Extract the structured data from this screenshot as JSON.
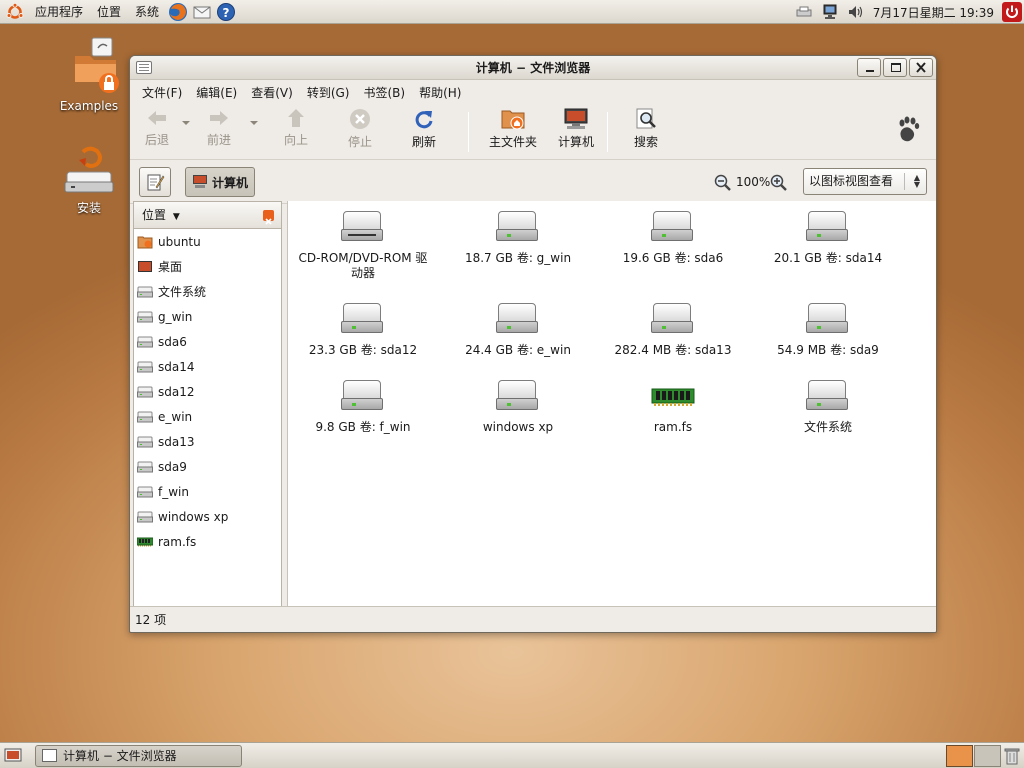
{
  "top_panel": {
    "menus": [
      "应用程序",
      "位置",
      "系统"
    ],
    "launchers": [
      "firefox-icon",
      "mail-icon",
      "help-icon"
    ],
    "clock": "7月17日星期二 19:39"
  },
  "desktop": {
    "icons": [
      {
        "label": "Examples",
        "icon": "folder-icon"
      },
      {
        "label": "安装",
        "icon": "installer-icon"
      }
    ]
  },
  "window": {
    "title": "计算机 − 文件浏览器",
    "menubar": [
      "文件(F)",
      "编辑(E)",
      "查看(V)",
      "转到(G)",
      "书签(B)",
      "帮助(H)"
    ],
    "toolbar": {
      "back": "后退",
      "forward": "前进",
      "up": "向上",
      "stop": "停止",
      "reload": "刷新",
      "home": "主文件夹",
      "computer": "计算机",
      "search": "搜索"
    },
    "location": {
      "current": "计算机",
      "zoom": "100%",
      "view_mode": "以图标视图查看"
    },
    "sidepane": {
      "header": "位置",
      "items": [
        "ubuntu",
        "桌面",
        "文件系统",
        "g_win",
        "sda6",
        "sda14",
        "sda12",
        "e_win",
        "sda13",
        "sda9",
        "f_win",
        "windows xp",
        "ram.fs"
      ]
    },
    "files": [
      {
        "label": "CD-ROM/DVD-ROM 驱动器",
        "icon": "cdrom-drive-icon"
      },
      {
        "label": "18.7 GB 卷: g_win",
        "icon": "harddisk-icon"
      },
      {
        "label": "19.6 GB 卷: sda6",
        "icon": "harddisk-icon"
      },
      {
        "label": "20.1 GB 卷: sda14",
        "icon": "harddisk-icon"
      },
      {
        "label": "23.3 GB 卷: sda12",
        "icon": "harddisk-icon"
      },
      {
        "label": "24.4 GB 卷: e_win",
        "icon": "harddisk-icon"
      },
      {
        "label": "282.4 MB 卷: sda13",
        "icon": "harddisk-icon"
      },
      {
        "label": "54.9 MB 卷: sda9",
        "icon": "harddisk-icon"
      },
      {
        "label": "9.8 GB 卷: f_win",
        "icon": "harddisk-icon"
      },
      {
        "label": "windows xp",
        "icon": "harddisk-icon"
      },
      {
        "label": "ram.fs",
        "icon": "ram-chip-icon"
      },
      {
        "label": "文件系统",
        "icon": "harddisk-icon"
      }
    ],
    "status": "12 项"
  },
  "bottom_panel": {
    "task": "计算机 − 文件浏览器"
  }
}
